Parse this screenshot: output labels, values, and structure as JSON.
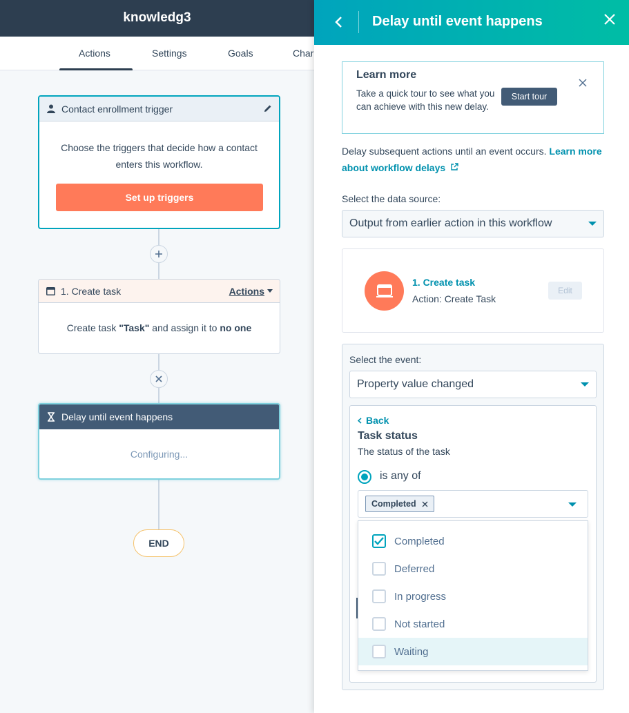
{
  "app": {
    "title": "knowledg3"
  },
  "tabs": [
    {
      "label": "Actions",
      "active": true
    },
    {
      "label": "Settings"
    },
    {
      "label": "Goals"
    },
    {
      "label": "Char"
    }
  ],
  "workflow": {
    "trigger": {
      "title": "Contact enrollment trigger",
      "body": "Choose the triggers that decide how a contact enters this workflow.",
      "button": "Set up triggers"
    },
    "create_task": {
      "title": "1. Create task",
      "actions_label": "Actions",
      "body_prefix": "Create task ",
      "body_task": "\"Task\"",
      "body_mid": " and assign it to ",
      "body_owner": "no one"
    },
    "delay": {
      "title": "Delay until event happens",
      "status": "Configuring..."
    },
    "end_label": "END"
  },
  "panel": {
    "title": "Delay until event happens",
    "learn_more": {
      "title": "Learn more",
      "text": "Take a quick tour to see what you can achieve with this new delay.",
      "button": "Start tour"
    },
    "description": "Delay subsequent actions until an event occurs. ",
    "description_link": "Learn more about workflow delays",
    "data_source_label": "Select the data source:",
    "data_source_value": "Output from earlier action in this workflow",
    "action": {
      "name": "1. Create task",
      "type": "Action: Create Task",
      "edit": "Edit"
    },
    "event_label": "Select the event:",
    "event_value": "Property value changed",
    "back": "Back",
    "property_title": "Task status",
    "property_sub": "The status of the task",
    "operator": "is any of",
    "selected_chip": "Completed",
    "options": [
      {
        "label": "Completed",
        "checked": true
      },
      {
        "label": "Deferred",
        "checked": false
      },
      {
        "label": "In progress",
        "checked": false
      },
      {
        "label": "Not started",
        "checked": false
      },
      {
        "label": "Waiting",
        "checked": false,
        "hover": true
      }
    ]
  },
  "colors": {
    "nav_dark": "#2d3e50",
    "teal": "#00a4bd",
    "orange": "#ff7a59",
    "link": "#0091ae"
  }
}
